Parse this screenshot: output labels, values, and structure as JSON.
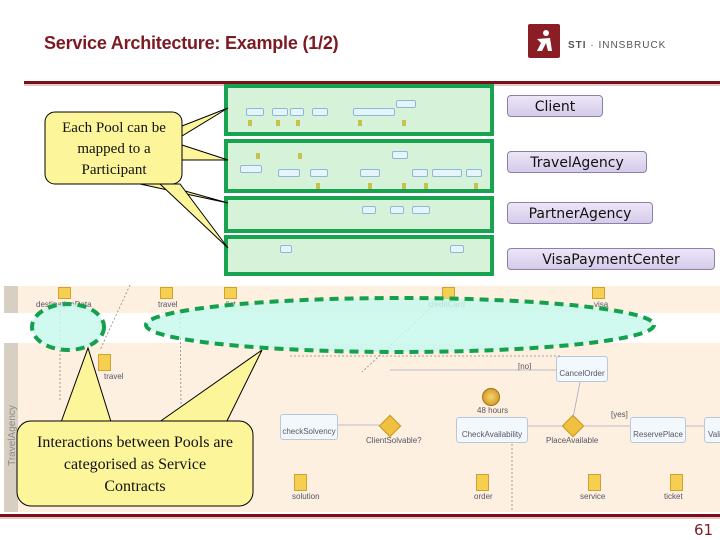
{
  "slide": {
    "title": "Service Architecture: Example (1/2)",
    "page_number": "61"
  },
  "logo": {
    "brand_bold": "STI",
    "brand_rest": "· INNSBRUCK",
    "color": "#8b1d24"
  },
  "participants": [
    {
      "label": "Client"
    },
    {
      "label": "TravelAgency"
    },
    {
      "label": "PartnerAgency"
    },
    {
      "label": "VisaPaymentCenter"
    }
  ],
  "callouts": {
    "pools": "Each Pool can be mapped to a Participant",
    "interactions": "Interactions between Pools are categorised as Service Contracts"
  },
  "diagram": {
    "lane_label": "TravelAgency",
    "tasks": [
      {
        "label": "checkSolvency"
      },
      {
        "label": "CheckAvailability"
      },
      {
        "label": "ReservePlace"
      },
      {
        "label": "CancelOrder"
      },
      {
        "label": "Vali"
      }
    ],
    "gateways": [
      {
        "label": "ClientSolvable?"
      },
      {
        "label": "PlaceAvailable"
      }
    ],
    "flow_labels": {
      "no": "[no]",
      "yes": "[yes]"
    },
    "timer_label": "48 hours",
    "top_messages": [
      "destinationData",
      "travel",
      "list",
      "creditCard",
      "visa"
    ],
    "mid_message": "travel",
    "bottom_documents": [
      "solution",
      "order",
      "service",
      "ticket"
    ]
  },
  "colors": {
    "title": "#7b1a22",
    "pool_border": "#17a350",
    "pool_fill": "#d6f2d8",
    "callout_fill": "#fdf59a",
    "ellipse_fill": "#c8f8ec",
    "ellipse_border": "#14a04e"
  }
}
